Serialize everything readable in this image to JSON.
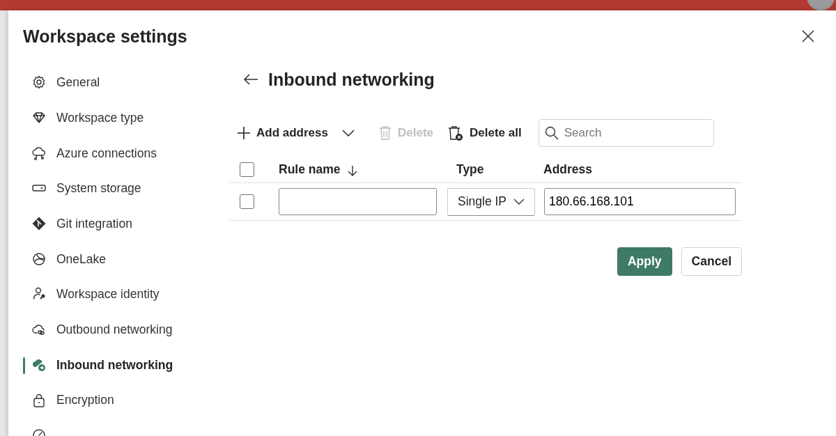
{
  "dialog": {
    "title": "Workspace settings"
  },
  "sidebar": {
    "items": [
      {
        "label": "General",
        "kind": "gear",
        "selected": false
      },
      {
        "label": "Workspace type",
        "kind": "diamond",
        "selected": false
      },
      {
        "label": "Azure connections",
        "kind": "cloud_link",
        "selected": false
      },
      {
        "label": "System storage",
        "kind": "storage",
        "selected": false
      },
      {
        "label": "Git integration",
        "kind": "git",
        "selected": false
      },
      {
        "label": "OneLake",
        "kind": "lake",
        "selected": false
      },
      {
        "label": "Workspace identity",
        "kind": "identity",
        "selected": false
      },
      {
        "label": "Outbound networking",
        "kind": "cloud_out",
        "selected": false
      },
      {
        "label": "Inbound networking",
        "kind": "cloud_in",
        "selected": true
      },
      {
        "label": "Encryption",
        "kind": "lock",
        "selected": false
      },
      {
        "kind": "gauge",
        "selected": false
      }
    ]
  },
  "page": {
    "title": "Inbound networking"
  },
  "toolbar": [
    {
      "label": "Add address",
      "kind": "add",
      "disabled": false
    },
    {
      "label": "Delete",
      "kind": "delete",
      "disabled": true
    },
    {
      "label": "Delete all",
      "kind": "delete_all",
      "disabled": false
    }
  ],
  "search": {
    "placeholder": "Search"
  },
  "table": {
    "header_checked": false,
    "columns": [
      {
        "label": "Rule name",
        "sorted": true
      },
      {
        "label": "Type",
        "sorted": false
      },
      {
        "label": "Address",
        "sorted": false
      }
    ],
    "rows": [
      {
        "checked": false,
        "type": "Single IP",
        "address": "180.66.168.101"
      }
    ]
  },
  "buttons": [
    {
      "label": "Apply",
      "kind": "primary"
    },
    {
      "label": "Cancel",
      "kind": "secondary"
    }
  ]
}
